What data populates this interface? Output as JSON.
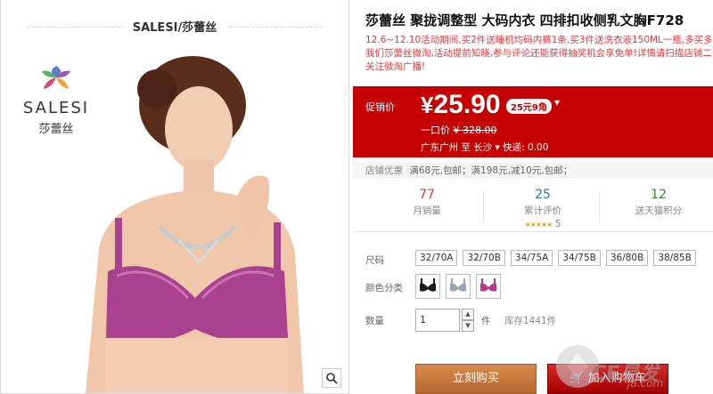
{
  "store": {
    "name": "SALESI/莎蕾丝",
    "logo_text": "SALESI",
    "logo_cn": "莎蕾丝"
  },
  "product": {
    "title": "莎蕾丝 聚拢调整型 大码内衣 四排扣收侧乳文胸F728",
    "promo_lines": [
      "12.6~12.10活动期间,买2件送睡机均码内裤1条,买3件送洗衣液150ML一瓶,多买多送噢!",
      "我们莎蕾丝微淘,活动提前知晓,参与评论还能获得抽奖机会享免单!详情请扫描店铺二维",
      "关注微淘广播!"
    ]
  },
  "price": {
    "label": "促销价",
    "currency": "¥",
    "value": "25.90",
    "badge": "25元9角",
    "original_label": "一口价",
    "original_value": "¥ 328.00",
    "shipping_from": "广东广州",
    "shipping_to_word": "至",
    "shipping_to": "长沙",
    "shipping_fee": "快递: 0.00"
  },
  "store_promo": {
    "label": "店铺优惠",
    "text": "满68元,包邮；满198元,减10元,包邮；"
  },
  "stats": {
    "monthly_sales": {
      "value": "77",
      "label": "月销量"
    },
    "reviews": {
      "value": "25",
      "label": "累计评价",
      "rating": "5",
      "stars": "★★★★★"
    },
    "points": {
      "value": "12",
      "label": "送天猫积分"
    }
  },
  "options": {
    "size_label": "尺码",
    "sizes": [
      "32/70A",
      "32/70B",
      "34/75A",
      "34/75B",
      "36/80B",
      "38/85B"
    ],
    "color_label": "颜色分类",
    "colors": [
      "#1a1a1a",
      "#9aa4b4",
      "#b03a8c"
    ]
  },
  "quantity": {
    "label": "数量",
    "value": "1",
    "unit": "件",
    "stock": "库存1441件"
  },
  "actions": {
    "buy_now": "立刻购买",
    "add_to_cart": "加入购物车"
  },
  "watermark": {
    "text": "CE易发",
    "url": "ja.com"
  }
}
